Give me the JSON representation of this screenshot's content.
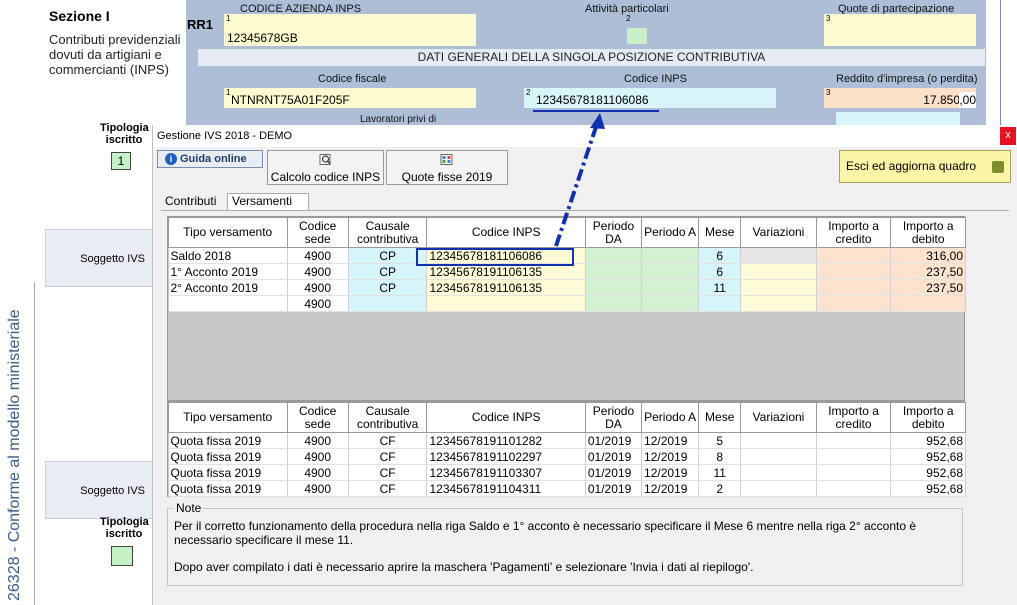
{
  "background": {
    "side_stamp": "26328 - Conforme al modello ministeriale",
    "section_title": "Sezione I",
    "section_desc": "Contributi previdenziali dovuti da artigiani e commercianti (INPS)",
    "row_code": "RR1",
    "codice_azienda_label": "CODICE AZIENDA INPS",
    "codice_azienda_value": "12345678GB",
    "attivita_label": "Attività particolari",
    "quote_label": "Quote di partecipazione",
    "dati_generali": "DATI GENERALI DELLA SINGOLA POSIZIONE CONTRIBUTIVA",
    "codice_fiscale_label": "Codice fiscale",
    "codice_fiscale_value": "NTNRNT75A01F205F",
    "codice_inps_label": "Codice INPS",
    "codice_inps_value": "12345678181106086",
    "reddito_label": "Reddito d'impresa (o perdita)",
    "reddito_value": "17.850",
    "reddito_cents": ",00",
    "lavoratori_label": "Lavoratori privi di",
    "field_nums": [
      "1",
      "2",
      "3",
      "1",
      "2",
      "3"
    ],
    "tipologia_label": "Tipologia iscritto",
    "tipologia_value": "1",
    "soggetto_label": "Soggetto IVS"
  },
  "dialog": {
    "title": "Gestione IVS 2018 - DEMO",
    "close_label": "x",
    "guida_label": "Guida online",
    "calcolo_label": "Calcolo codice INPS",
    "quote_fisse_label": "Quote fisse 2019",
    "esci_label": "Esci ed aggiorna quadro",
    "tabs": [
      "Contributi",
      "Versamenti"
    ],
    "columns": [
      "Tipo versamento",
      "Codice sede",
      "Causale contributiva",
      "Codice INPS",
      "Periodo DA",
      "Periodo A",
      "Mese",
      "Variazioni",
      "Importo a credito",
      "Importo a debito"
    ],
    "versamenti_rows": [
      [
        "Saldo 2018",
        "4900",
        "CP",
        "12345678181106086",
        "",
        "",
        "6",
        "",
        "",
        "316,00"
      ],
      [
        "1° Acconto 2019",
        "4900",
        "CP",
        "12345678191106135",
        "",
        "",
        "6",
        "",
        "",
        "237,50"
      ],
      [
        "2° Acconto 2019",
        "4900",
        "CP",
        "12345678191106135",
        "",
        "",
        "11",
        "",
        "",
        "237,50"
      ],
      [
        "",
        "4900",
        "",
        "",
        "",
        "",
        "",
        "",
        "",
        ""
      ]
    ],
    "quote_rows": [
      [
        "Quota fissa 2019",
        "4900",
        "CF",
        "12345678191101282",
        "01/2019",
        "12/2019",
        "5",
        "",
        "",
        "952,68"
      ],
      [
        "Quota fissa 2019",
        "4900",
        "CF",
        "12345678191102297",
        "01/2019",
        "12/2019",
        "8",
        "",
        "",
        "952,68"
      ],
      [
        "Quota fissa 2019",
        "4900",
        "CF",
        "12345678191103307",
        "01/2019",
        "12/2019",
        "11",
        "",
        "",
        "952,68"
      ],
      [
        "Quota fissa 2019",
        "4900",
        "CF",
        "12345678191104311",
        "01/2019",
        "12/2019",
        "2",
        "",
        "",
        "952,68"
      ]
    ],
    "note_legend": "Note",
    "note_text1": "Per il corretto funzionamento della procedura nella riga Saldo e 1° acconto è necessario specificare il Mese 6 mentre nella riga 2° acconto è necessario specificare il mese 11.",
    "note_text2": "Dopo aver compilato i dati è necessario aprire la maschera 'Pagamenti' e selezionare 'Invia i dati al riepilogo'."
  },
  "colors": {
    "annotation": "#1030b0",
    "accent_yellow": "#fbf5a6"
  }
}
